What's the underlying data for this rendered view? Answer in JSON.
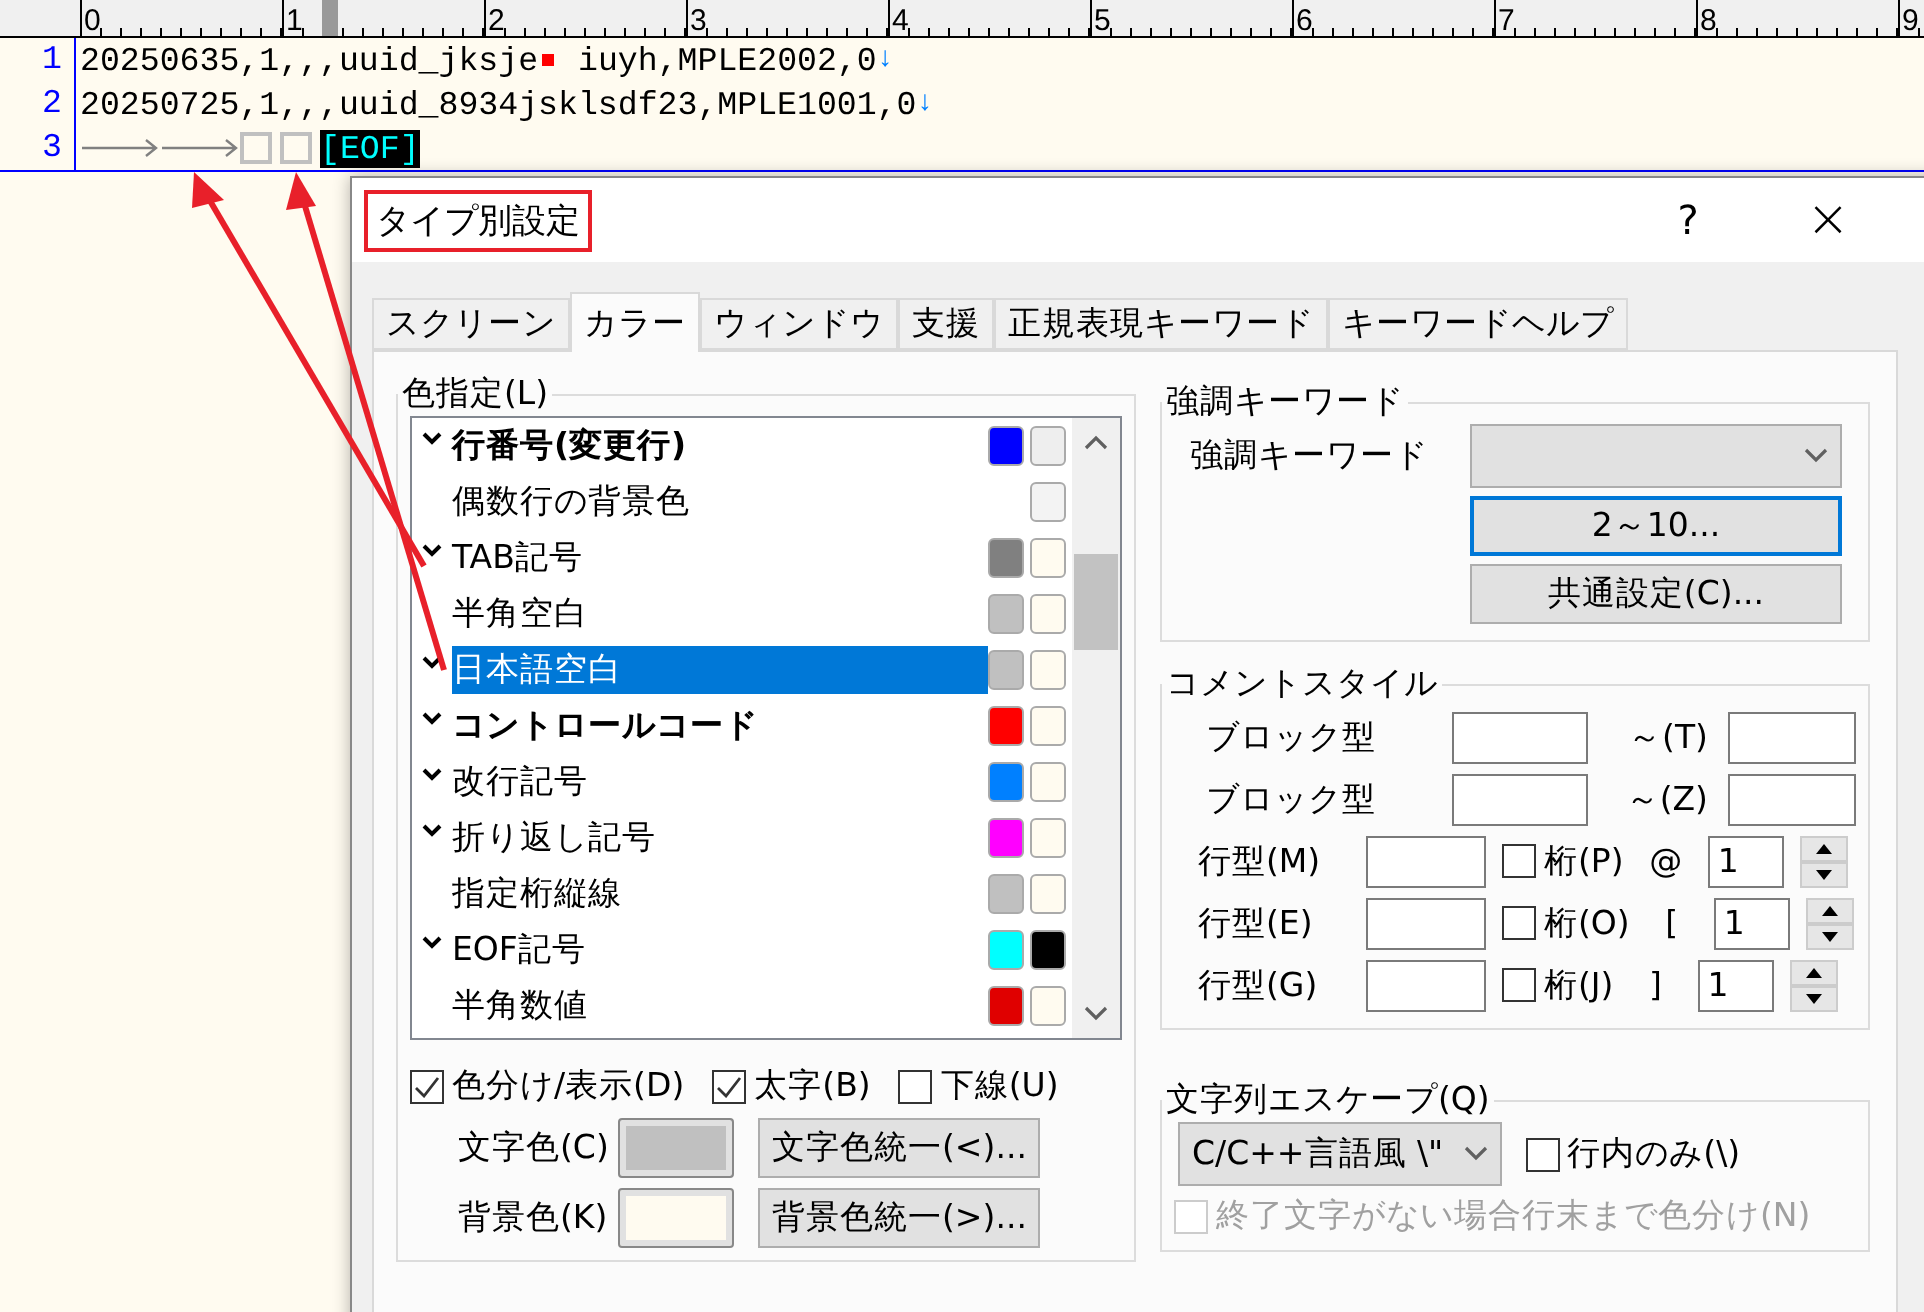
{
  "editor": {
    "ruler": [
      "0",
      "1",
      "2",
      "3",
      "4",
      "5",
      "6",
      "7",
      "8",
      "9"
    ],
    "lines": [
      {
        "number": "1",
        "tokens": [
          {
            "kind": "text",
            "text": "20250635,1,,,uuid_jksje"
          },
          {
            "kind": "control"
          },
          {
            "kind": "text",
            "text": " iuyh,MPLE2002,0"
          },
          {
            "kind": "newline",
            "text": "↓"
          }
        ]
      },
      {
        "number": "2",
        "tokens": [
          {
            "kind": "text",
            "text": "20250725,1,,,uuid_8934jsklsdf23,MPLE1001,0"
          },
          {
            "kind": "newline",
            "text": "↓"
          }
        ]
      },
      {
        "number": "3",
        "tokens": [
          {
            "kind": "tab"
          },
          {
            "kind": "tab"
          },
          {
            "kind": "wide_space"
          },
          {
            "kind": "wide_space"
          },
          {
            "kind": "eof",
            "text": "[EOF]"
          }
        ]
      }
    ]
  },
  "dialog": {
    "title": "タイプ別設定",
    "title_marked": true,
    "help": "?",
    "close": "×",
    "tabs": [
      {
        "label": "スクリーン",
        "selected": false
      },
      {
        "label": "カラー",
        "selected": true
      },
      {
        "label": "ウィンドウ",
        "selected": false
      },
      {
        "label": "支援",
        "selected": false
      },
      {
        "label": "正規表現キーワード",
        "selected": false
      },
      {
        "label": "キーワードヘルプ",
        "selected": false
      }
    ],
    "color_group": {
      "label": "色指定(L)",
      "items": [
        {
          "label": "行番号(変更行)",
          "checked": true,
          "bold": true,
          "selected": false,
          "swatches": [
            {
              "kind": "text",
              "color": "#0000ff"
            },
            {
              "kind": "back",
              "color": "#eeeeee"
            }
          ]
        },
        {
          "label": "偶数行の背景色",
          "checked": false,
          "bold": false,
          "selected": false,
          "swatches": [
            {
              "kind": "back",
              "color": "#f3f3f3"
            }
          ]
        },
        {
          "label": "TAB記号",
          "checked": true,
          "bold": false,
          "selected": false,
          "swatches": [
            {
              "kind": "text",
              "color": "#808080"
            },
            {
              "kind": "back",
              "color": "#fffbf0"
            }
          ]
        },
        {
          "label": "半角空白",
          "checked": false,
          "bold": false,
          "selected": false,
          "swatches": [
            {
              "kind": "text",
              "color": "#c0c0c0"
            },
            {
              "kind": "back",
              "color": "#fffbf0"
            }
          ]
        },
        {
          "label": "日本語空白",
          "checked": true,
          "bold": false,
          "selected": true,
          "swatches": [
            {
              "kind": "text",
              "color": "#c0c0c0"
            },
            {
              "kind": "back",
              "color": "#fffbf0"
            }
          ]
        },
        {
          "label": "コントロールコード",
          "checked": true,
          "bold": true,
          "selected": false,
          "swatches": [
            {
              "kind": "text",
              "color": "#ff0000"
            },
            {
              "kind": "back",
              "color": "#fffbf0"
            }
          ]
        },
        {
          "label": "改行記号",
          "checked": true,
          "bold": false,
          "selected": false,
          "swatches": [
            {
              "kind": "text",
              "color": "#0080ff"
            },
            {
              "kind": "back",
              "color": "#fffbf0"
            }
          ]
        },
        {
          "label": "折り返し記号",
          "checked": true,
          "bold": false,
          "selected": false,
          "swatches": [
            {
              "kind": "text",
              "color": "#ff00ff"
            },
            {
              "kind": "back",
              "color": "#fffbf0"
            }
          ]
        },
        {
          "label": "指定桁縦線",
          "checked": false,
          "bold": false,
          "selected": false,
          "swatches": [
            {
              "kind": "text",
              "color": "#c0c0c0"
            },
            {
              "kind": "back",
              "color": "#fffbf0"
            }
          ]
        },
        {
          "label": "EOF記号",
          "checked": true,
          "bold": false,
          "selected": false,
          "swatches": [
            {
              "kind": "text",
              "color": "#00ffff"
            },
            {
              "kind": "back",
              "color": "#000000"
            }
          ]
        },
        {
          "label": "半角数値",
          "checked": false,
          "bold": false,
          "selected": false,
          "swatches": [
            {
              "kind": "text",
              "color": "#e00000"
            },
            {
              "kind": "back",
              "color": "#fffbf0"
            }
          ]
        }
      ],
      "options": [
        {
          "label": "色分け/表示(D)",
          "checked": true
        },
        {
          "label": "太字(B)",
          "checked": true
        },
        {
          "label": "下線(U)",
          "checked": false
        }
      ],
      "color_rows": [
        {
          "label": "文字色(C)",
          "color": "#c0c0c0",
          "button": "文字色統一(<)..."
        },
        {
          "label": "背景色(K)",
          "color": "#fffbf0",
          "button": "背景色統一(>)..."
        }
      ]
    },
    "keyword_group": {
      "label": "強調キーワード",
      "field_label": "強調キーワード",
      "buttons": [
        {
          "label": "2～10...",
          "focused": true
        },
        {
          "label": "共通設定(C)...",
          "focused": false
        }
      ]
    },
    "comment_group": {
      "label": "コメントスタイル",
      "block_rows": [
        {
          "label": "ブロック型",
          "separator": "～(T)"
        },
        {
          "label": "ブロック型",
          "separator": "～(Z)"
        }
      ],
      "line_rows": [
        {
          "label": "行型(M)",
          "check_label": "桁(P)",
          "checked": false,
          "marker": "@",
          "value": "1"
        },
        {
          "label": "行型(E)",
          "check_label": "桁(O)",
          "checked": false,
          "marker": "[",
          "value": "1"
        },
        {
          "label": "行型(G)",
          "check_label": "桁(J)",
          "checked": false,
          "marker": "]",
          "value": "1"
        }
      ]
    },
    "escape_group": {
      "label": "文字列エスケープ(Q)",
      "select": "C/C++言語風 \\\"",
      "options": [
        {
          "label": "行内のみ(\\)",
          "checked": false,
          "disabled": false
        },
        {
          "label": "終了文字がない場合行末まで色分け(N)",
          "checked": false,
          "disabled": true
        }
      ]
    }
  }
}
